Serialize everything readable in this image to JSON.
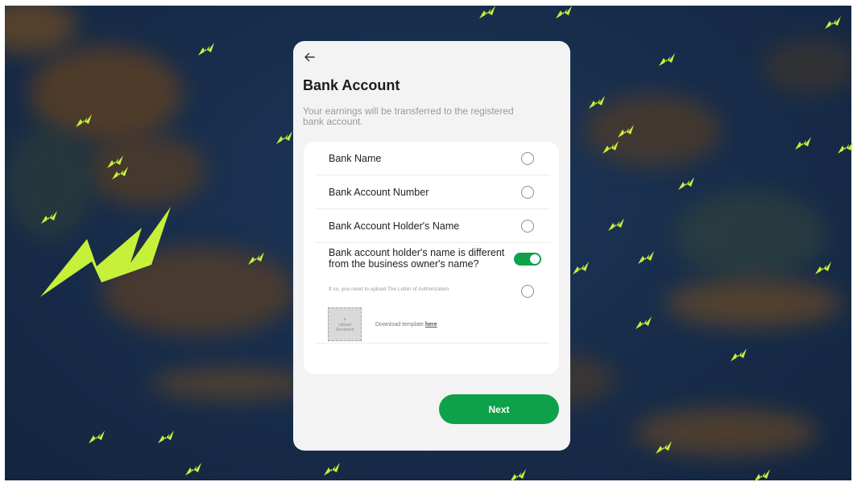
{
  "colors": {
    "accent": "#0fa14a",
    "bolt": "#c6f03a",
    "ocean": "#172c4a",
    "land": "#6b4a25"
  },
  "header": {
    "back_icon": "arrow-left-icon",
    "title": "Bank Account",
    "subtitle": "Your earnings will be transferred to the registered bank account."
  },
  "form": {
    "fields": [
      {
        "label": "Bank Name",
        "selected": false
      },
      {
        "label": "Bank Account Number",
        "selected": false
      },
      {
        "label": "Bank Account Holder's Name",
        "selected": false
      }
    ],
    "different_name": {
      "label": "Bank account holder's name is different from the business owner's name?",
      "enabled": true
    },
    "authorization_note": "If so, you need to upload The Letter of Authorization",
    "upload": {
      "plus": "+",
      "label": "Upload Document",
      "download_prefix": "Download template",
      "download_link": "here"
    }
  },
  "footer": {
    "next_label": "Next"
  }
}
